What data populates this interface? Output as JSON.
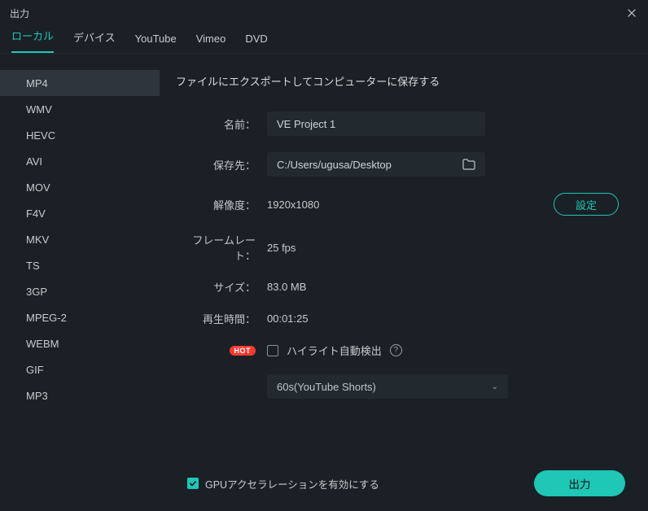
{
  "window": {
    "title": "出力"
  },
  "tabs": [
    {
      "label": "ローカル",
      "active": true
    },
    {
      "label": "デバイス"
    },
    {
      "label": "YouTube"
    },
    {
      "label": "Vimeo"
    },
    {
      "label": "DVD"
    }
  ],
  "formats": [
    "MP4",
    "WMV",
    "HEVC",
    "AVI",
    "MOV",
    "F4V",
    "MKV",
    "TS",
    "3GP",
    "MPEG-2",
    "WEBM",
    "GIF",
    "MP3"
  ],
  "selected_format": "MP4",
  "main": {
    "heading": "ファイルにエクスポートしてコンピューターに保存する",
    "name_label": "名前：",
    "name_value": "VE Project 1",
    "saveto_label": "保存先：",
    "saveto_value": "C:/Users/ugusa/Desktop",
    "resolution_label": "解像度：",
    "resolution_value": "1920x1080",
    "settings_btn": "設定",
    "framerate_label": "フレームレート：",
    "framerate_value": "25 fps",
    "size_label": "サイズ：",
    "size_value": "83.0 MB",
    "duration_label": "再生時間：",
    "duration_value": "00:01:25",
    "hot_label": "HOT",
    "highlight_label": "ハイライト自動検出",
    "preset_value": "60s(YouTube Shorts)"
  },
  "footer": {
    "gpu_label": "GPUアクセラレーションを有効にする",
    "export_btn": "出力"
  }
}
